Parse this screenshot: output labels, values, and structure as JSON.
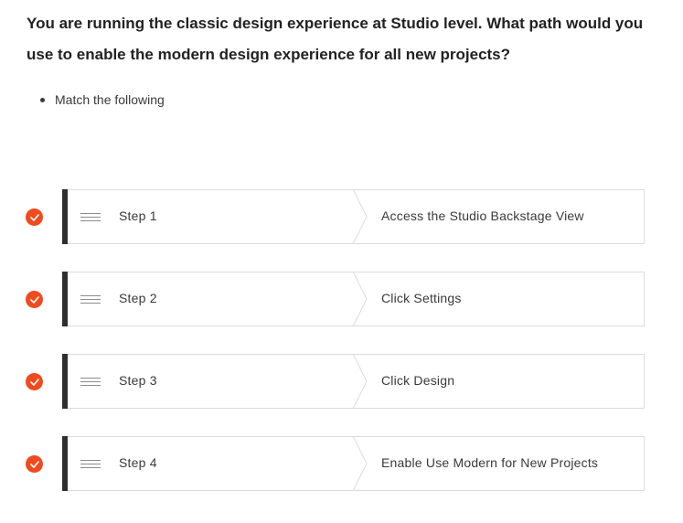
{
  "question": {
    "text": "You are running the classic design experience at Studio level. What path would you use to enable the modern design experience for all new projects?"
  },
  "instructions": [
    "Match the following"
  ],
  "colors": {
    "accent": "#ef4b1f",
    "bar": "#2f2f2f",
    "border": "#dcdcdc"
  },
  "pairs": [
    {
      "step": "Step 1",
      "answer": "Access the Studio Backstage View",
      "status": "correct"
    },
    {
      "step": "Step 2",
      "answer": "Click Settings",
      "status": "correct"
    },
    {
      "step": "Step 3",
      "answer": "Click Design",
      "status": "correct"
    },
    {
      "step": "Step 4",
      "answer": "Enable Use Modern for New Projects",
      "status": "correct"
    }
  ]
}
